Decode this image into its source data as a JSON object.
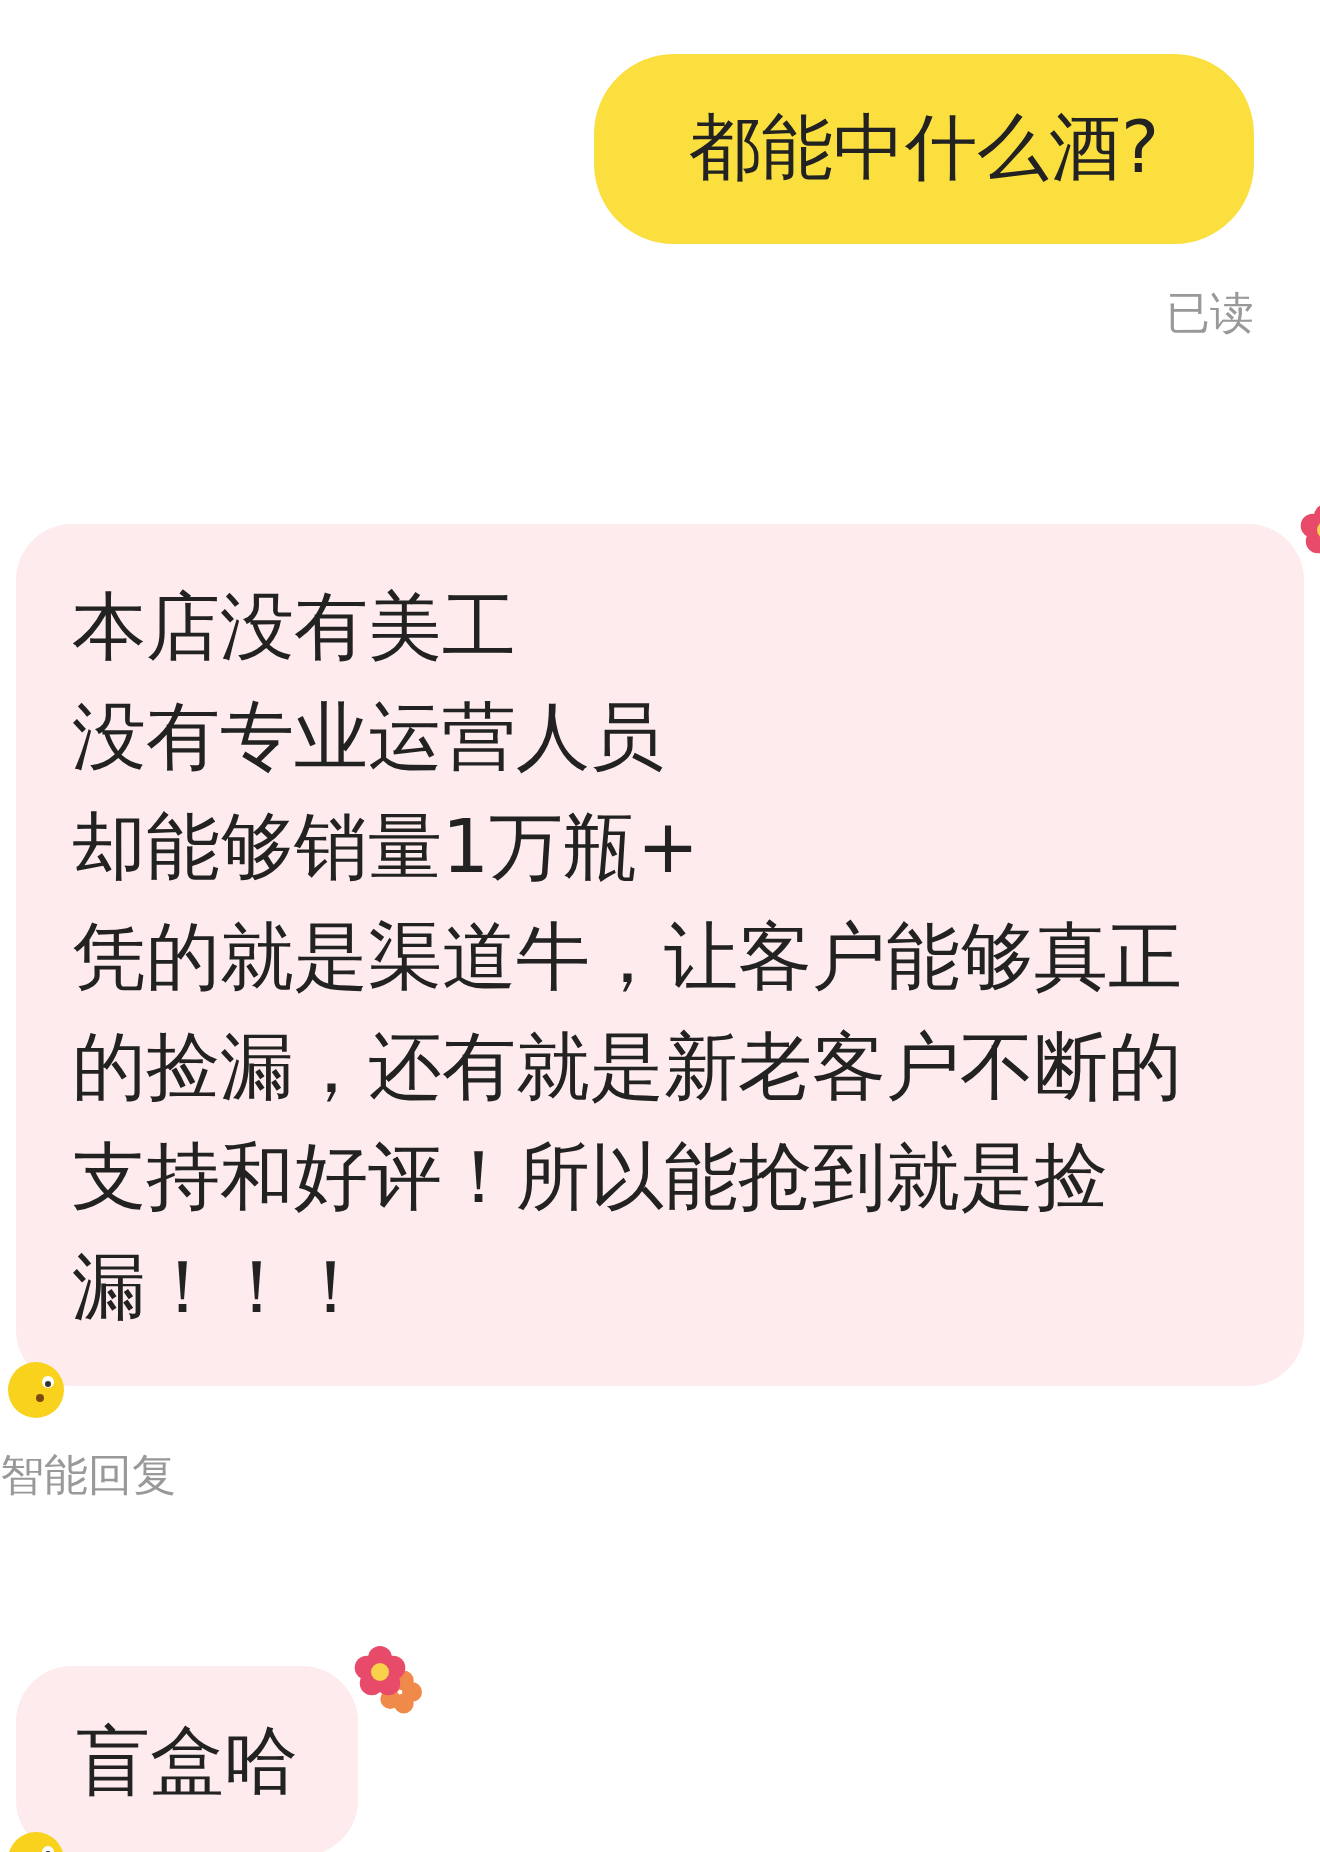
{
  "messages": [
    {
      "kind": "outgoing",
      "lines": [
        "都能中什么酒?"
      ],
      "status": "已读"
    },
    {
      "kind": "incoming",
      "lines": [
        "本店没有美工",
        "没有专业运营人员",
        "却能够销量1万瓶+",
        "凭的就是渠道牛，让客户能够真正的捡漏，还有就是新老客户不断的支持和好评！所以能抢到就是捡漏！！！"
      ],
      "note": "智能回复"
    },
    {
      "kind": "incoming",
      "lines": [
        "盲盒哈"
      ]
    }
  ]
}
